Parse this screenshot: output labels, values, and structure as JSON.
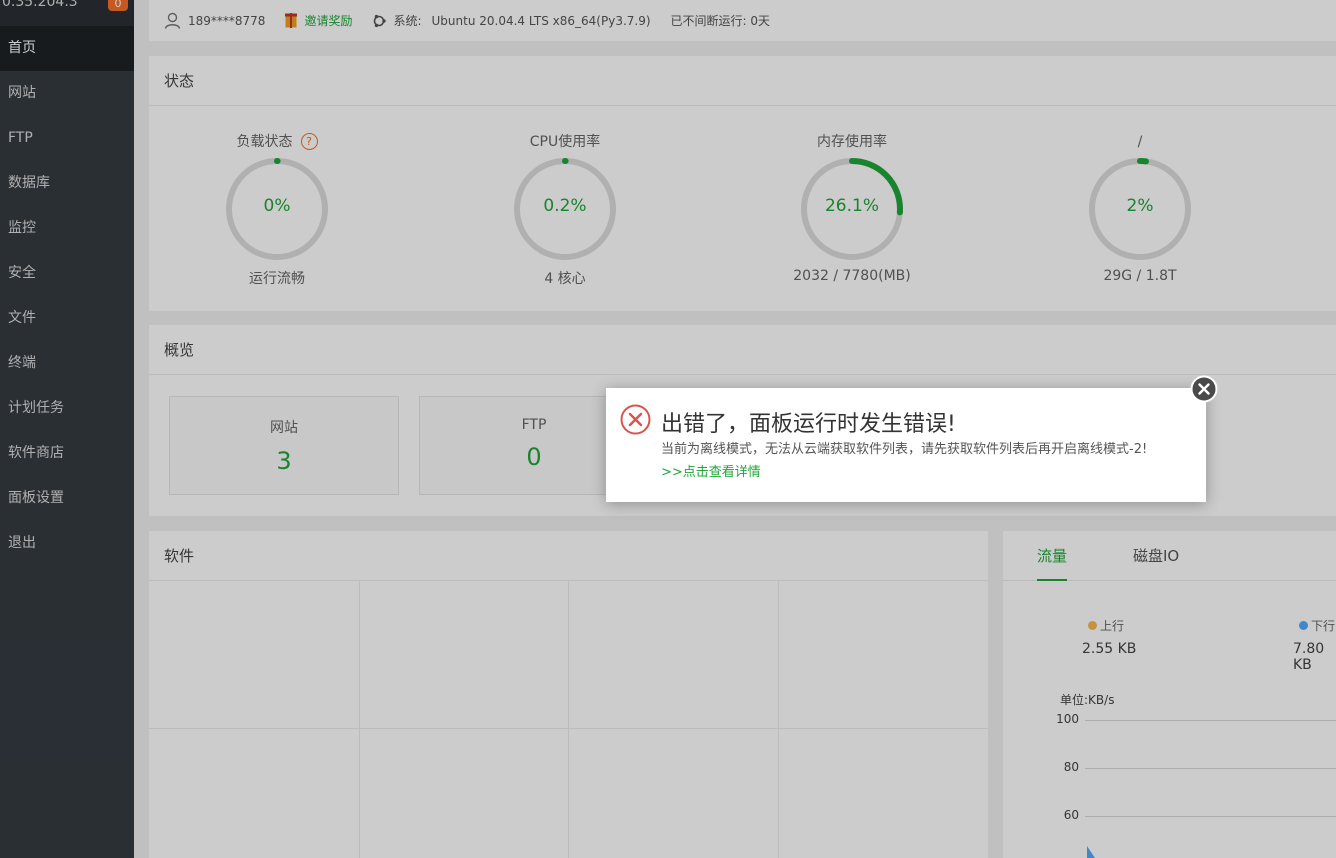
{
  "sidebar": {
    "ip": "0.35.204.3",
    "badge": "0",
    "items": [
      {
        "label": "首页",
        "active": true
      },
      {
        "label": "网站"
      },
      {
        "label": "FTP"
      },
      {
        "label": "数据库"
      },
      {
        "label": "监控"
      },
      {
        "label": "安全"
      },
      {
        "label": "文件"
      },
      {
        "label": "终端"
      },
      {
        "label": "计划任务"
      },
      {
        "label": "软件商店"
      },
      {
        "label": "面板设置"
      },
      {
        "label": "退出"
      }
    ]
  },
  "topbar": {
    "user": "189****8778",
    "invite": "邀请奖励",
    "system_label": "系统:",
    "system_value": "Ubuntu 20.04.4 LTS x86_64(Py3.7.9)",
    "uptime": "已不间断运行: 0天"
  },
  "status": {
    "title": "状态",
    "gauges": [
      {
        "label": "负载状态",
        "value": "0%",
        "sub": "运行流畅",
        "percent": 0
      },
      {
        "label": "CPU使用率",
        "value": "0.2%",
        "sub": "4 核心",
        "percent": 0.2
      },
      {
        "label": "内存使用率",
        "value": "26.1%",
        "sub": "2032 / 7780(MB)",
        "percent": 26.1
      },
      {
        "label": "/",
        "value": "2%",
        "sub": "29G / 1.8T",
        "percent": 2
      }
    ]
  },
  "overview": {
    "title": "概览",
    "boxes": [
      {
        "label": "网站",
        "value": "3"
      },
      {
        "label": "FTP",
        "value": "0"
      }
    ]
  },
  "software": {
    "title": "软件"
  },
  "traffic": {
    "tabs": [
      "流量",
      "磁盘IO"
    ],
    "up_label": "上行",
    "up_value": "2.55 KB",
    "down_label": "下行",
    "down_value": "7.80 KB",
    "unit": "单位:KB/s",
    "y_ticks": [
      "100",
      "80",
      "60"
    ],
    "colors": {
      "up": "#f7b851",
      "down": "#52a9ff"
    }
  },
  "dialog": {
    "title": "出错了，面板运行时发生错误!",
    "message": "当前为离线模式，无法从云端获取软件列表，请先获取软件列表后再开启离线模式-2!",
    "link": ">>点击查看详情"
  },
  "colors": {
    "accent": "#20a53a",
    "warning": "#f7702a",
    "error": "#d9534f"
  }
}
